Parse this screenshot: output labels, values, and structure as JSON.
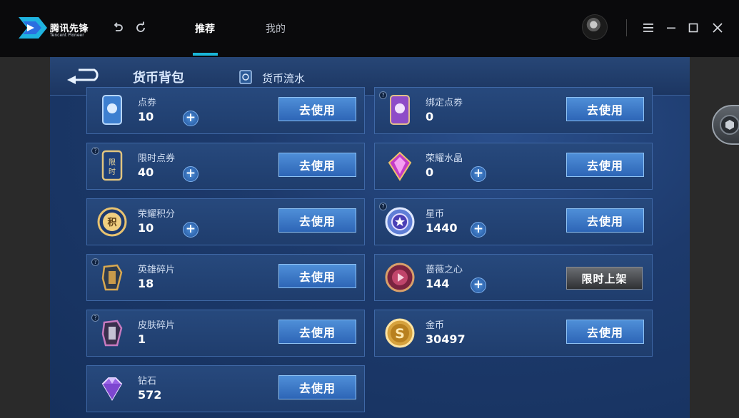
{
  "app": {
    "logo_name": "腾讯先锋",
    "logo_sub": "Tencent Pioneer",
    "nav_tabs": [
      {
        "label": "推荐",
        "active": true
      },
      {
        "label": "我的",
        "active": false
      }
    ],
    "accent": "#19b6d8"
  },
  "game_header": {
    "title": "货币背包",
    "flow_label": "货币流水"
  },
  "currencies": [
    {
      "name": "点券",
      "value": "10",
      "has_plus": true,
      "button": "去使用",
      "icon": "ticket-card-icon",
      "help": false
    },
    {
      "name": "绑定点券",
      "value": "0",
      "has_plus": false,
      "button": "去使用",
      "icon": "bound-ticket-card-icon",
      "help": true
    },
    {
      "name": "限时点券",
      "value": "40",
      "has_plus": true,
      "button": "去使用",
      "icon": "limited-ticket-icon",
      "help": true
    },
    {
      "name": "荣耀水晶",
      "value": "0",
      "has_plus": true,
      "button": "去使用",
      "icon": "glory-crystal-icon",
      "help": false
    },
    {
      "name": "荣耀积分",
      "value": "10",
      "has_plus": true,
      "button": "去使用",
      "icon": "glory-points-coin-icon",
      "help": false
    },
    {
      "name": "星币",
      "value": "1440",
      "has_plus": true,
      "button": "去使用",
      "icon": "star-coin-icon",
      "help": true
    },
    {
      "name": "英雄碎片",
      "value": "18",
      "has_plus": false,
      "button": "去使用",
      "icon": "hero-fragment-icon",
      "help": true
    },
    {
      "name": "蔷薇之心",
      "value": "144",
      "has_plus": true,
      "button": "限时上架",
      "button_style": "limited",
      "icon": "rose-heart-icon",
      "help": false
    },
    {
      "name": "皮肤碎片",
      "value": "1",
      "has_plus": false,
      "button": "去使用",
      "icon": "skin-fragment-icon",
      "help": true
    },
    {
      "name": "金币",
      "value": "30497",
      "has_plus": false,
      "button": "去使用",
      "icon": "gold-coin-icon",
      "help": false
    },
    {
      "name": "钻石",
      "value": "572",
      "has_plus": false,
      "button": "去使用",
      "icon": "diamond-icon",
      "help": false
    }
  ]
}
